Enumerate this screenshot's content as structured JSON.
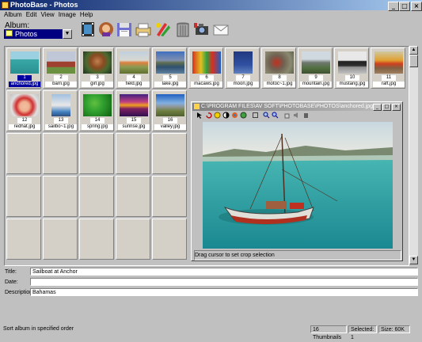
{
  "window": {
    "title": "PhotoBase - Photos"
  },
  "menu": [
    "Album",
    "Edit",
    "View",
    "Image",
    "Help"
  ],
  "album": {
    "label": "Album:",
    "selected": "Photos"
  },
  "toolbar_icons": [
    "film-frame-icon",
    "person-portrait-icon",
    "floppy-disk-icon",
    "printer-icon",
    "paint-tools-icon",
    "trash-can-icon",
    "camera-icon",
    "envelope-icon"
  ],
  "thumbnails": [
    {
      "num": "1",
      "name": "anchored.jpg",
      "selected": true
    },
    {
      "num": "2",
      "name": "barn.jpg"
    },
    {
      "num": "3",
      "name": "girl.jpg"
    },
    {
      "num": "4",
      "name": "field.jpg"
    },
    {
      "num": "5",
      "name": "lake.jpg"
    },
    {
      "num": "6",
      "name": "macaws.jpg"
    },
    {
      "num": "7",
      "name": "moon.jpg"
    },
    {
      "num": "8",
      "name": "motoc~1.jpg"
    },
    {
      "num": "9",
      "name": "mountain.jpg"
    },
    {
      "num": "10",
      "name": "mustang.jpg"
    },
    {
      "num": "11",
      "name": "raft.jpg"
    },
    {
      "num": "12",
      "name": "redhat.jpg"
    },
    {
      "num": "13",
      "name": "sailbo~1.jpg"
    },
    {
      "num": "14",
      "name": "spring.jpg"
    },
    {
      "num": "15",
      "name": "sunrise.jpg"
    },
    {
      "num": "16",
      "name": "valley.jpg"
    }
  ],
  "preview": {
    "title": "C:\\PROGRAM FILES\\AV SOFT\\PHOTOBASE\\PHOTOS\\anchored.jpg",
    "status": "Drag cursor to set crop selection"
  },
  "fields": {
    "title_label": "Title:",
    "title_value": "Sailboat at Anchor",
    "date_label": "Date:",
    "date_value": "",
    "description_label": "Description:",
    "description_value": "Bahamas"
  },
  "status": {
    "message": "Sort album in specified order",
    "thumbnails": "16 Thumbnails",
    "selected": "Selected: 1",
    "size": "Size: 60K"
  },
  "colors": {
    "titlebar": "#0a246a",
    "selection": "#0000a0"
  }
}
